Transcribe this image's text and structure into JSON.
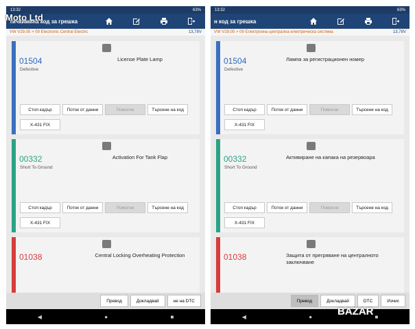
{
  "watermark_top": "Moto Ltd",
  "watermark_bottom": "BAZAR",
  "left": {
    "status_time": "13:32",
    "status_battery": "63%",
    "title": "тичкимина код за грешка",
    "breadcrumb": "VW V29.05 > 09 Electronic Central Electric",
    "voltage": "13,78V",
    "cards": [
      {
        "code": "01504",
        "status": "Defective",
        "desc": "License Plate Lamp"
      },
      {
        "code": "00332",
        "status": "Short To Ground",
        "desc": "Activation For Tank Flap"
      },
      {
        "code": "01038",
        "status": "",
        "desc": "Central Locking Overheating Protection"
      }
    ],
    "buttons": {
      "freeze": "Стоп кадър",
      "stream": "Поток от данни",
      "help": "Помогне",
      "search": "Търсене на код",
      "fix": "X-431 FIX"
    },
    "bottom": {
      "translate": "Превод",
      "report": "Докладвай",
      "clear": "не на DTC"
    }
  },
  "right": {
    "status_time": "13:32",
    "status_battery": "63%",
    "title": "н код за грешка",
    "breadcrumb": "VW V29.05 > 09 Електронна централна електрическа система",
    "voltage": "13,78V",
    "cards": [
      {
        "code": "01504",
        "status": "Defective",
        "desc": "Лампа за регистрационен номер"
      },
      {
        "code": "00332",
        "status": "Short To Ground",
        "desc": "Активиране на капака на резервоара"
      },
      {
        "code": "01038",
        "status": "",
        "desc": "Защита от прегряване на централното заключване"
      }
    ],
    "buttons": {
      "freeze": "Стоп кадър",
      "stream": "Поток от данни",
      "help": "Помогне",
      "search": "Търсене на код",
      "fix": "X-431 FIX"
    },
    "bottom": {
      "translate": "Превод",
      "report": "Докладвай",
      "clear": "DTC",
      "exit": "Изчис"
    }
  }
}
